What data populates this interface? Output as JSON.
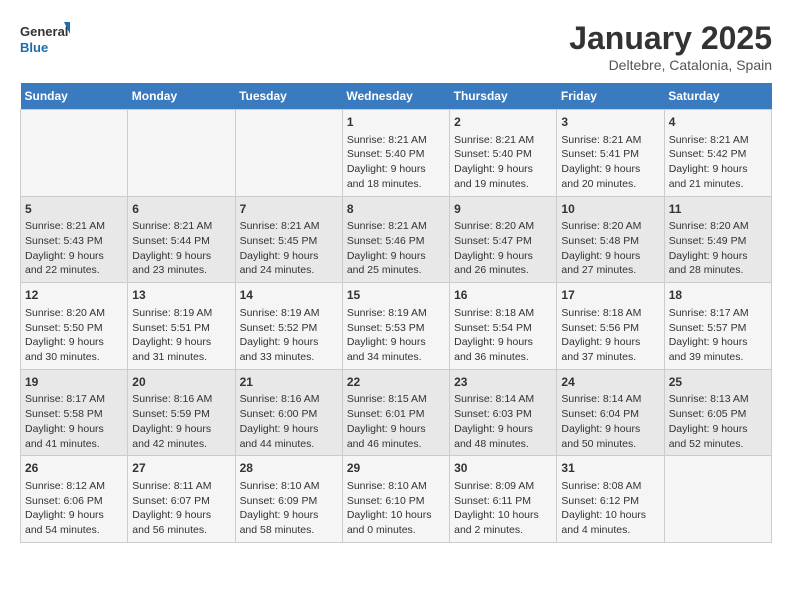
{
  "logo": {
    "line1": "General",
    "line2": "Blue"
  },
  "title": "January 2025",
  "subtitle": "Deltebre, Catalonia, Spain",
  "days_of_week": [
    "Sunday",
    "Monday",
    "Tuesday",
    "Wednesday",
    "Thursday",
    "Friday",
    "Saturday"
  ],
  "weeks": [
    [
      {
        "day": "",
        "info": ""
      },
      {
        "day": "",
        "info": ""
      },
      {
        "day": "",
        "info": ""
      },
      {
        "day": "1",
        "info": "Sunrise: 8:21 AM\nSunset: 5:40 PM\nDaylight: 9 hours\nand 18 minutes."
      },
      {
        "day": "2",
        "info": "Sunrise: 8:21 AM\nSunset: 5:40 PM\nDaylight: 9 hours\nand 19 minutes."
      },
      {
        "day": "3",
        "info": "Sunrise: 8:21 AM\nSunset: 5:41 PM\nDaylight: 9 hours\nand 20 minutes."
      },
      {
        "day": "4",
        "info": "Sunrise: 8:21 AM\nSunset: 5:42 PM\nDaylight: 9 hours\nand 21 minutes."
      }
    ],
    [
      {
        "day": "5",
        "info": "Sunrise: 8:21 AM\nSunset: 5:43 PM\nDaylight: 9 hours\nand 22 minutes."
      },
      {
        "day": "6",
        "info": "Sunrise: 8:21 AM\nSunset: 5:44 PM\nDaylight: 9 hours\nand 23 minutes."
      },
      {
        "day": "7",
        "info": "Sunrise: 8:21 AM\nSunset: 5:45 PM\nDaylight: 9 hours\nand 24 minutes."
      },
      {
        "day": "8",
        "info": "Sunrise: 8:21 AM\nSunset: 5:46 PM\nDaylight: 9 hours\nand 25 minutes."
      },
      {
        "day": "9",
        "info": "Sunrise: 8:20 AM\nSunset: 5:47 PM\nDaylight: 9 hours\nand 26 minutes."
      },
      {
        "day": "10",
        "info": "Sunrise: 8:20 AM\nSunset: 5:48 PM\nDaylight: 9 hours\nand 27 minutes."
      },
      {
        "day": "11",
        "info": "Sunrise: 8:20 AM\nSunset: 5:49 PM\nDaylight: 9 hours\nand 28 minutes."
      }
    ],
    [
      {
        "day": "12",
        "info": "Sunrise: 8:20 AM\nSunset: 5:50 PM\nDaylight: 9 hours\nand 30 minutes."
      },
      {
        "day": "13",
        "info": "Sunrise: 8:19 AM\nSunset: 5:51 PM\nDaylight: 9 hours\nand 31 minutes."
      },
      {
        "day": "14",
        "info": "Sunrise: 8:19 AM\nSunset: 5:52 PM\nDaylight: 9 hours\nand 33 minutes."
      },
      {
        "day": "15",
        "info": "Sunrise: 8:19 AM\nSunset: 5:53 PM\nDaylight: 9 hours\nand 34 minutes."
      },
      {
        "day": "16",
        "info": "Sunrise: 8:18 AM\nSunset: 5:54 PM\nDaylight: 9 hours\nand 36 minutes."
      },
      {
        "day": "17",
        "info": "Sunrise: 8:18 AM\nSunset: 5:56 PM\nDaylight: 9 hours\nand 37 minutes."
      },
      {
        "day": "18",
        "info": "Sunrise: 8:17 AM\nSunset: 5:57 PM\nDaylight: 9 hours\nand 39 minutes."
      }
    ],
    [
      {
        "day": "19",
        "info": "Sunrise: 8:17 AM\nSunset: 5:58 PM\nDaylight: 9 hours\nand 41 minutes."
      },
      {
        "day": "20",
        "info": "Sunrise: 8:16 AM\nSunset: 5:59 PM\nDaylight: 9 hours\nand 42 minutes."
      },
      {
        "day": "21",
        "info": "Sunrise: 8:16 AM\nSunset: 6:00 PM\nDaylight: 9 hours\nand 44 minutes."
      },
      {
        "day": "22",
        "info": "Sunrise: 8:15 AM\nSunset: 6:01 PM\nDaylight: 9 hours\nand 46 minutes."
      },
      {
        "day": "23",
        "info": "Sunrise: 8:14 AM\nSunset: 6:03 PM\nDaylight: 9 hours\nand 48 minutes."
      },
      {
        "day": "24",
        "info": "Sunrise: 8:14 AM\nSunset: 6:04 PM\nDaylight: 9 hours\nand 50 minutes."
      },
      {
        "day": "25",
        "info": "Sunrise: 8:13 AM\nSunset: 6:05 PM\nDaylight: 9 hours\nand 52 minutes."
      }
    ],
    [
      {
        "day": "26",
        "info": "Sunrise: 8:12 AM\nSunset: 6:06 PM\nDaylight: 9 hours\nand 54 minutes."
      },
      {
        "day": "27",
        "info": "Sunrise: 8:11 AM\nSunset: 6:07 PM\nDaylight: 9 hours\nand 56 minutes."
      },
      {
        "day": "28",
        "info": "Sunrise: 8:10 AM\nSunset: 6:09 PM\nDaylight: 9 hours\nand 58 minutes."
      },
      {
        "day": "29",
        "info": "Sunrise: 8:10 AM\nSunset: 6:10 PM\nDaylight: 10 hours\nand 0 minutes."
      },
      {
        "day": "30",
        "info": "Sunrise: 8:09 AM\nSunset: 6:11 PM\nDaylight: 10 hours\nand 2 minutes."
      },
      {
        "day": "31",
        "info": "Sunrise: 8:08 AM\nSunset: 6:12 PM\nDaylight: 10 hours\nand 4 minutes."
      },
      {
        "day": "",
        "info": ""
      }
    ]
  ]
}
